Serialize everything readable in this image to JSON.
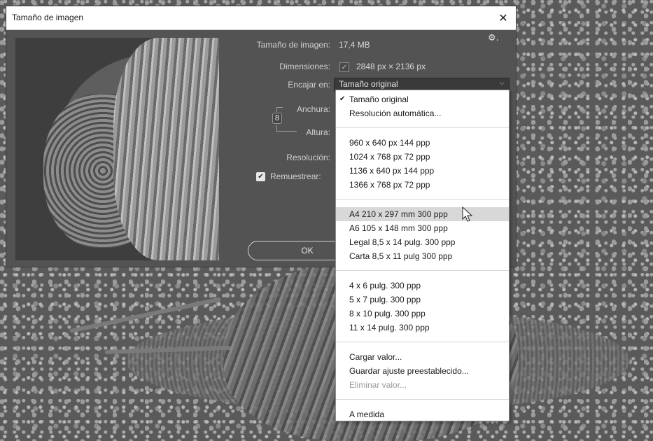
{
  "window": {
    "title": "Tamaño de imagen",
    "close_glyph": "✕"
  },
  "info": {
    "size_label": "Tamaño de imagen:",
    "size_value": "17,4 MB",
    "dims_label": "Dimensiones:",
    "dims_value": "2848 px × 2136 px",
    "fit_label": "Encajar en:",
    "fit_value": "Tamaño original",
    "width_label": "Anchura:",
    "height_label": "Altura:",
    "resolution_label": "Resolución:",
    "resample_label": "Remuestrear:",
    "resample_checked": true
  },
  "buttons": {
    "ok": "OK"
  },
  "icons": {
    "settings": "gear-icon",
    "link": "link-icon",
    "close": "close-icon",
    "chevron": "chevron-down-icon"
  },
  "dropdown": {
    "groups": [
      [
        {
          "label": "Tamaño original",
          "checked": true
        },
        {
          "label": "Resolución automática..."
        }
      ],
      [
        {
          "label": "960 x 640 px 144 ppp"
        },
        {
          "label": "1024 x 768 px 72 ppp"
        },
        {
          "label": "1136 x 640 px 144 ppp"
        },
        {
          "label": "1366 x 768 px 72 ppp"
        }
      ],
      [
        {
          "label": "A4 210 x 297 mm 300 ppp",
          "hover": true
        },
        {
          "label": "A6 105 x 148 mm 300 ppp"
        },
        {
          "label": "Legal 8,5 x 14 pulg. 300 ppp"
        },
        {
          "label": "Carta 8,5 x 11 pulg 300 ppp"
        }
      ],
      [
        {
          "label": "4 x 6 pulg. 300 ppp"
        },
        {
          "label": "5 x 7 pulg. 300 ppp"
        },
        {
          "label": "8 x 10 pulg. 300 ppp"
        },
        {
          "label": "11 x 14 pulg. 300 ppp"
        }
      ],
      [
        {
          "label": "Cargar valor..."
        },
        {
          "label": "Guardar ajuste preestablecido..."
        },
        {
          "label": "Eliminar valor...",
          "disabled": true
        }
      ],
      [
        {
          "label": "A medida"
        }
      ]
    ]
  },
  "colors": {
    "dialog_bg": "#535353",
    "hover_bg": "#d8d8d8"
  }
}
